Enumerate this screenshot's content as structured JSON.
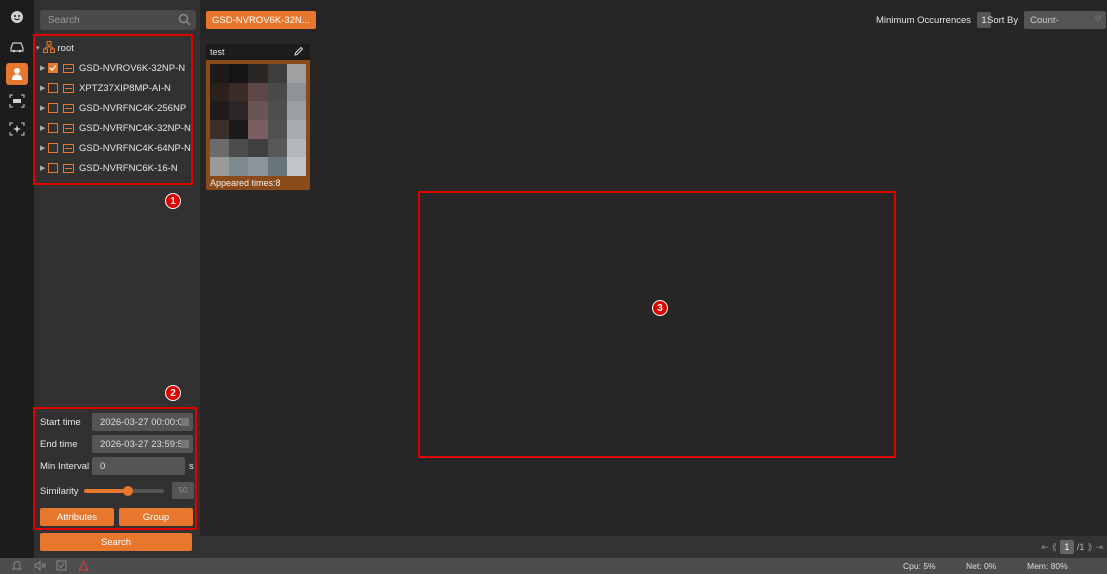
{
  "search": {
    "placeholder": "Search"
  },
  "tree": {
    "root_label": "root",
    "devices": [
      {
        "label": "GSD-NVROV6K-32NP-N",
        "checked": true
      },
      {
        "label": "XPTZ37XIP8MP-AI-N",
        "checked": false
      },
      {
        "label": "GSD-NVRFNC4K-256NP",
        "checked": false
      },
      {
        "label": "GSD-NVRFNC4K-32NP-N",
        "checked": false
      },
      {
        "label": "GSD-NVRFNC4K-64NP-N",
        "checked": false
      },
      {
        "label": "GSD-NVRFNC6K-16-N",
        "checked": false
      }
    ]
  },
  "filters": {
    "start_label": "Start time",
    "start_value": "2026-03-27 00:00:00",
    "end_label": "End time",
    "end_value": "2026-03-27 23:59:59",
    "interval_label": "Min Interval",
    "interval_value": "0",
    "interval_unit": "s",
    "similarity_label": "Similarity",
    "similarity_level": 0.55,
    "similarity_value": "50",
    "attributes_label": "Attributes",
    "group_label": "Group",
    "search_button": "Search"
  },
  "main": {
    "device_tag": "GSD-NVROV6K-32N...",
    "min_occ_label": "Minimum Occurrences",
    "min_occ_value": "1",
    "sort_label": "Sort By",
    "sort_value": "Count-"
  },
  "card": {
    "title": "test",
    "footer": "Appeared times:8"
  },
  "callouts": {
    "one": "1",
    "two": "2",
    "three": "3"
  },
  "pager": {
    "current": "1",
    "total": "/1"
  },
  "status": {
    "cpu": "Cpu: 5%",
    "net": "Net: 0%",
    "mem": "Mem: 80%"
  },
  "colors": {
    "accent": "#e8772e",
    "annotation": "#e00000"
  }
}
